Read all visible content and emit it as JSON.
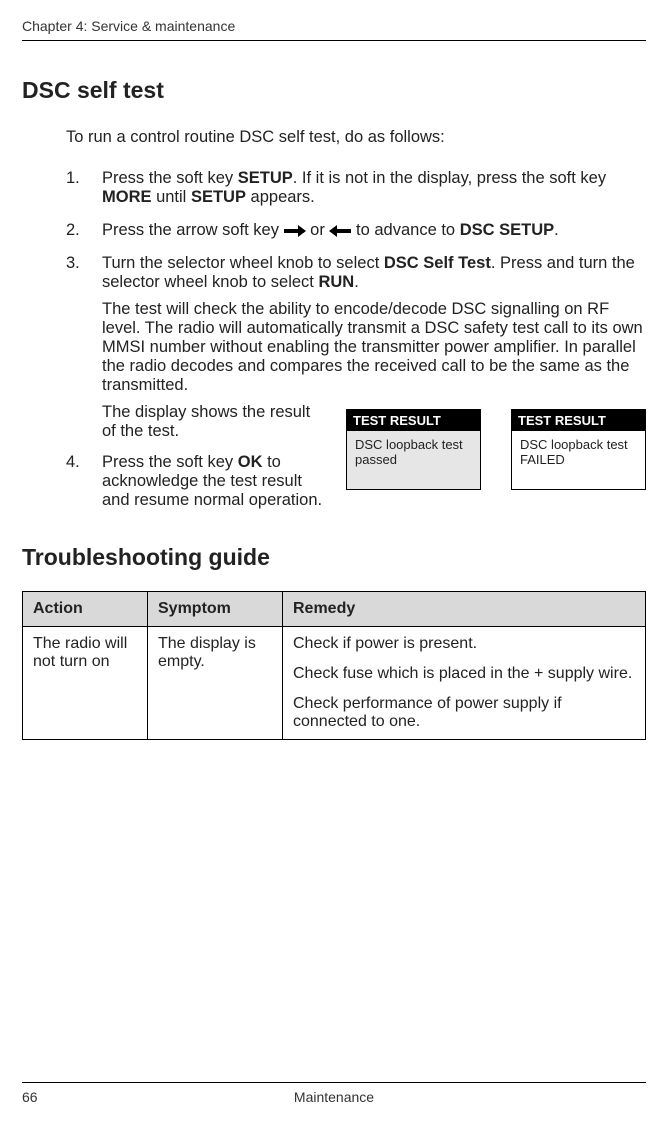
{
  "chapter_line": "Chapter 4:  Service & maintenance",
  "section_title": "DSC self test",
  "intro": "To run a control routine DSC self test, do as follows:",
  "steps": {
    "s1": {
      "num": "1.",
      "text_pre": "Press the soft key ",
      "setup": "SETUP",
      "text_mid": ". If it is not in the display, press the soft key ",
      "more": "MORE",
      "text_mid2": " until ",
      "setup2": "SETUP",
      "text_end": " appears."
    },
    "s2": {
      "num": "2.",
      "text_pre": "Press the arrow soft key ",
      "or": " or ",
      "text_mid": " to advance to ",
      "dsc_setup": "DSC SETUP",
      "text_end": "."
    },
    "s3": {
      "num": "3.",
      "text_pre": "Turn the selector wheel knob to select ",
      "dsc_self_test": "DSC Self Test",
      "text_mid": ". Press and turn the selector wheel knob to select ",
      "run": "RUN",
      "text_end": ".",
      "para2": "The test will check the ability to encode/decode DSC signalling on RF level. The radio will automatically transmit a DSC safety test call to its own MMSI number without enabling the transmitter power amplifier. In parallel the radio decodes and compares the received call to be the same as the transmitted."
    },
    "s4": {
      "num": "4.",
      "display_line": "The display shows the result of the test.",
      "text_pre": "Press the soft key ",
      "ok": "OK",
      "text_end": " to acknowledge the test result and resume normal operation."
    }
  },
  "result_boxes": {
    "passed": {
      "head": "TEST RESULT",
      "body": "DSC loopback test passed"
    },
    "failed": {
      "head": "TEST RESULT",
      "body": "DSC loopback test FAILED"
    }
  },
  "trouble_title": "Troubleshooting guide",
  "table": {
    "headers": {
      "action": "Action",
      "symptom": "Symptom",
      "remedy": "Remedy"
    },
    "row1": {
      "action": "The radio will not turn on",
      "symptom": "The display is empty.",
      "remedy1": "Check if power is present.",
      "remedy2": "Check fuse which is placed in the + supply wire.",
      "remedy3": "Check performance of power supply if connected to one."
    }
  },
  "footer": {
    "page": "66",
    "title": "Maintenance"
  }
}
